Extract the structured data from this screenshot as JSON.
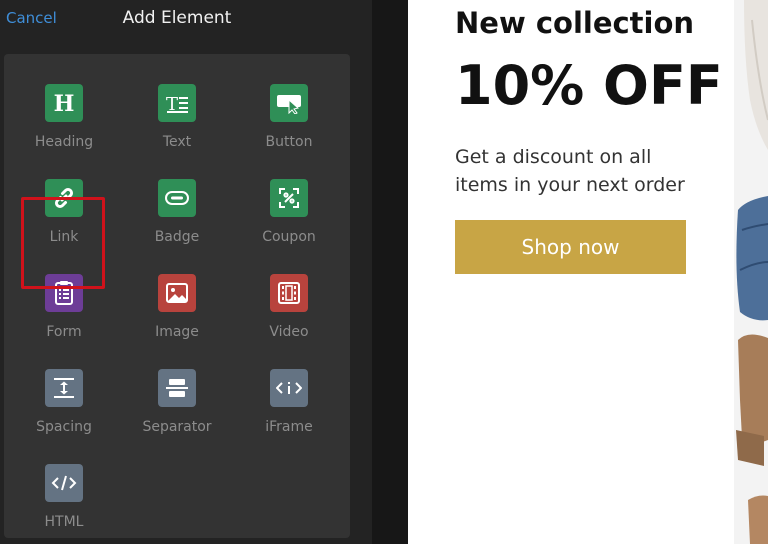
{
  "header": {
    "cancel_label": "Cancel",
    "title": "Add Element"
  },
  "elements": [
    {
      "label": "Heading",
      "icon": "heading-icon",
      "color": "#2f8f57"
    },
    {
      "label": "Text",
      "icon": "text-icon",
      "color": "#2f8f57"
    },
    {
      "label": "Button",
      "icon": "button-icon",
      "color": "#2f8f57"
    },
    {
      "label": "Link",
      "icon": "link-icon",
      "color": "#2f8f57"
    },
    {
      "label": "Badge",
      "icon": "badge-icon",
      "color": "#2f8f57"
    },
    {
      "label": "Coupon",
      "icon": "coupon-icon",
      "color": "#2f8f57"
    },
    {
      "label": "Form",
      "icon": "form-icon",
      "color": "#6d3d97",
      "selected": true
    },
    {
      "label": "Image",
      "icon": "image-icon",
      "color": "#b8433d"
    },
    {
      "label": "Video",
      "icon": "video-icon",
      "color": "#b8433d"
    },
    {
      "label": "Spacing",
      "icon": "spacing-icon",
      "color": "#647383"
    },
    {
      "label": "Separator",
      "icon": "separator-icon",
      "color": "#647383"
    },
    {
      "label": "iFrame",
      "icon": "iframe-icon",
      "color": "#647383"
    },
    {
      "label": "HTML",
      "icon": "html-icon",
      "color": "#647383"
    }
  ],
  "preview": {
    "headline": "New collection",
    "promo": "10% OFF",
    "description": "Get a discount on all items in your next order",
    "button_label": "Shop now",
    "button_color": "#c8a545"
  }
}
